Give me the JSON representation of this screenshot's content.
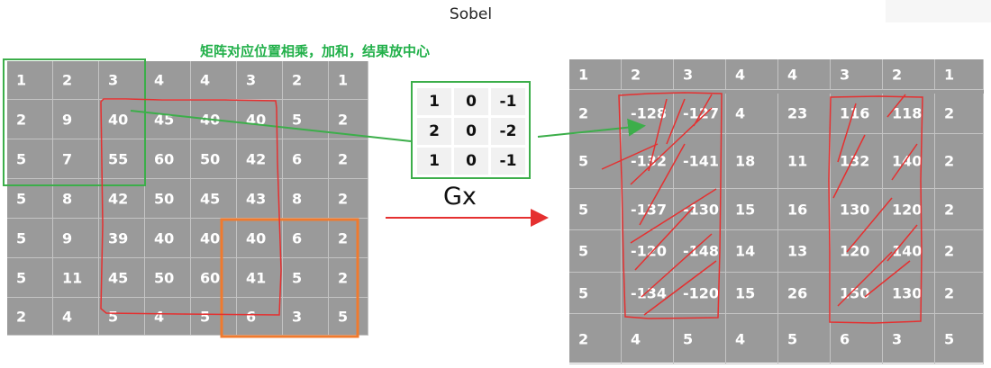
{
  "title": "Sobel",
  "note": "矩阵对应位置相乘，加和，结果放中心",
  "kernel_label": "Gx",
  "input_matrix": [
    [
      "1",
      "2",
      "3",
      "4",
      "4",
      "3",
      "2",
      "1"
    ],
    [
      "2",
      "9",
      "40",
      "45",
      "40",
      "40",
      "5",
      "2"
    ],
    [
      "5",
      "7",
      "55",
      "60",
      "50",
      "42",
      "6",
      "2"
    ],
    [
      "5",
      "8",
      "42",
      "50",
      "45",
      "43",
      "8",
      "2"
    ],
    [
      "5",
      "9",
      "39",
      "40",
      "40",
      "40",
      "6",
      "2"
    ],
    [
      "5",
      "11",
      "45",
      "50",
      "60",
      "41",
      "5",
      "2"
    ],
    [
      "2",
      "4",
      "5",
      "4",
      "5",
      "6",
      "3",
      "5"
    ]
  ],
  "kernel": [
    [
      "1",
      "0",
      "-1"
    ],
    [
      "2",
      "0",
      "-2"
    ],
    [
      "1",
      "0",
      "-1"
    ]
  ],
  "output_matrix": [
    [
      "1",
      "2",
      "3",
      "4",
      "4",
      "3",
      "2",
      "1"
    ],
    [
      "2",
      "-128",
      "-127",
      "4",
      "23",
      "116",
      "118",
      "2"
    ],
    [
      "5",
      "-132",
      "-141",
      "18",
      "11",
      "132",
      "140",
      "2"
    ],
    [
      "5",
      "-137",
      "-130",
      "15",
      "16",
      "130",
      "120",
      "2"
    ],
    [
      "5",
      "-120",
      "-148",
      "14",
      "13",
      "120",
      "140",
      "2"
    ],
    [
      "5",
      "-134",
      "-120",
      "15",
      "26",
      "150",
      "130",
      "2"
    ],
    [
      "2",
      "4",
      "5",
      "4",
      "5",
      "6",
      "3",
      "5"
    ]
  ],
  "colors": {
    "cell_bg": "#9a9a9a",
    "cell_text": "#ffffff",
    "green": "#3cae4a",
    "red": "#e53030",
    "orange": "#f07a2e"
  }
}
